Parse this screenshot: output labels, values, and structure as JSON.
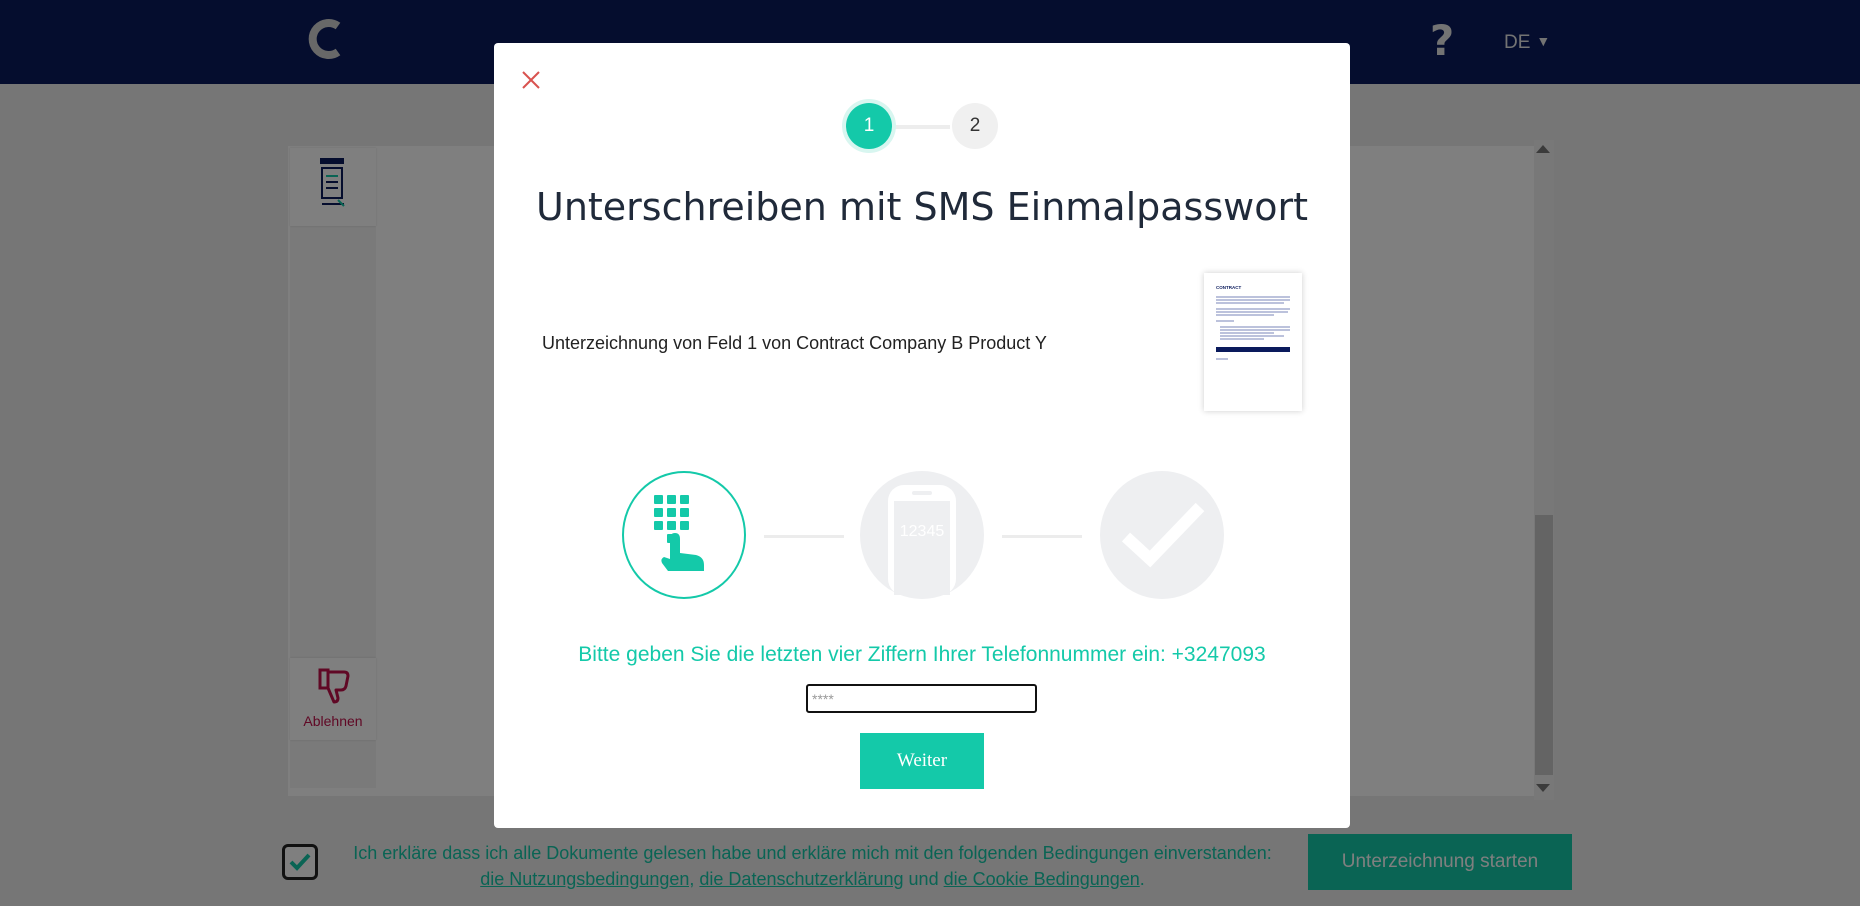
{
  "header": {
    "logo_icon": "company-logo-icon",
    "help_label": "?",
    "language": "DE",
    "language_caret": "▼"
  },
  "sidebar": {
    "document_icon": "document-icon",
    "decline_icon": "thumbs-down-icon",
    "decline_label": "Ablehnen"
  },
  "consent": {
    "text_before": "Ich erkläre dass ich alle Dokumente gelesen habe und erkläre mich mit den folgenden Bedingungen einverstanden:",
    "link_terms": "die Nutzungsbedingungen,",
    "link_privacy": "die Datenschutzerklärung",
    "connector": "und",
    "link_cookies": "die Cookie Bedingungen",
    "period": ".",
    "start_button": "Unterzeichnung starten",
    "checked": true
  },
  "modal": {
    "close_icon": "close-icon",
    "steps": [
      "1",
      "2"
    ],
    "active_step": 1,
    "title": "Unterschreiben mit SMS Einmalpasswort",
    "description": "Unterzeichnung von Feld 1 von Contract Company B Product Y",
    "document_preview_title": "CONTRACT",
    "progress": {
      "icons": [
        "keypad-touch-icon",
        "phone-code-icon",
        "checkmark-icon"
      ],
      "phone_code": "12345"
    },
    "prompt": "Bitte geben Sie die letzten vier Ziffern Ihrer Telefonnummer ein: +3247093",
    "input_value": "",
    "input_placeholder": "****",
    "next_button": "Weiter"
  },
  "colors": {
    "accent": "#14c9a9",
    "header_bg": "#0a1a5c",
    "decline": "#c0114a",
    "close": "#d9534f"
  }
}
